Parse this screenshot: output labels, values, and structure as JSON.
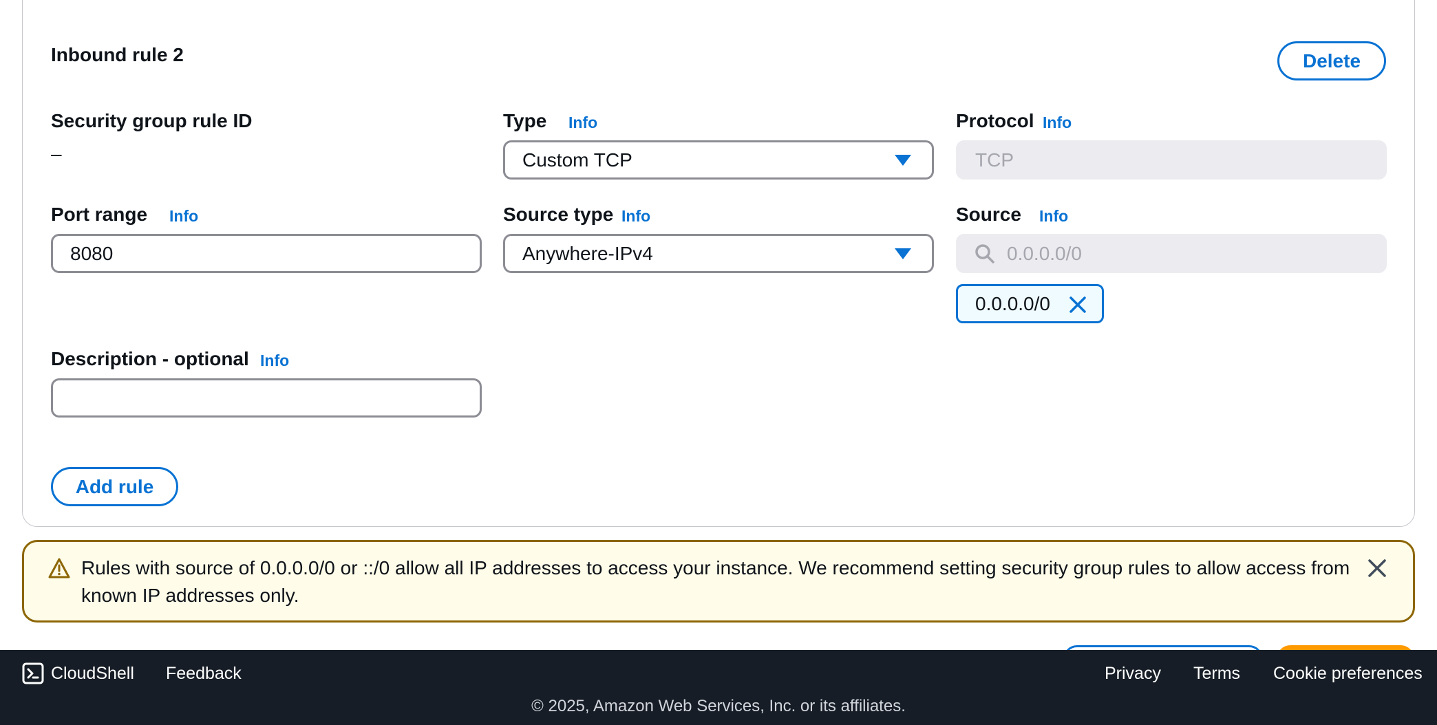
{
  "rule": {
    "title": "Inbound rule 2",
    "delete_label": "Delete",
    "sg_rule_id_label": "Security group rule ID",
    "sg_rule_id_value": "–",
    "type_label": "Type",
    "type_value": "Custom TCP",
    "protocol_label": "Protocol",
    "protocol_value": "TCP",
    "port_range_label": "Port range",
    "port_range_value": "8080",
    "source_type_label": "Source type",
    "source_type_value": "Anywhere-IPv4",
    "source_label": "Source",
    "source_placeholder": "0.0.0.0/0",
    "source_token": "0.0.0.0/0",
    "description_label": "Description - optional",
    "description_value": "",
    "info_label": "Info"
  },
  "add_rule_label": "Add rule",
  "alert": {
    "text": "Rules with source of 0.0.0.0/0 or ::/0 allow all IP addresses to access your instance. We recommend setting security group rules to allow access from known IP addresses only."
  },
  "footer": {
    "cloudshell": "CloudShell",
    "feedback": "Feedback",
    "privacy": "Privacy",
    "terms": "Terms",
    "cookie": "Cookie preferences",
    "copyright": "© 2025, Amazon Web Services, Inc. or its affiliates."
  },
  "colors": {
    "accent": "#0972d3",
    "warning_border": "#8d6605",
    "warning_bg": "#fffce9",
    "footer_bg": "#161d26"
  }
}
